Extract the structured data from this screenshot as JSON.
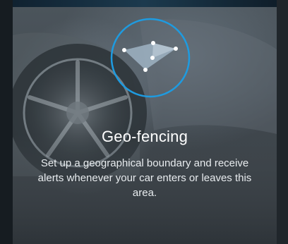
{
  "feature": {
    "title": "Geo-fencing",
    "description": "Set up a geographical boundary and receive alerts whenever your car enters or leaves this area."
  },
  "icons": {
    "main": "geo-fence-polygon-icon"
  },
  "colors": {
    "accent_ring": "#1e9be0",
    "fence_fill": "#9fb3c3",
    "title_text": "#ffffff",
    "body_text": "#e8ecef"
  }
}
